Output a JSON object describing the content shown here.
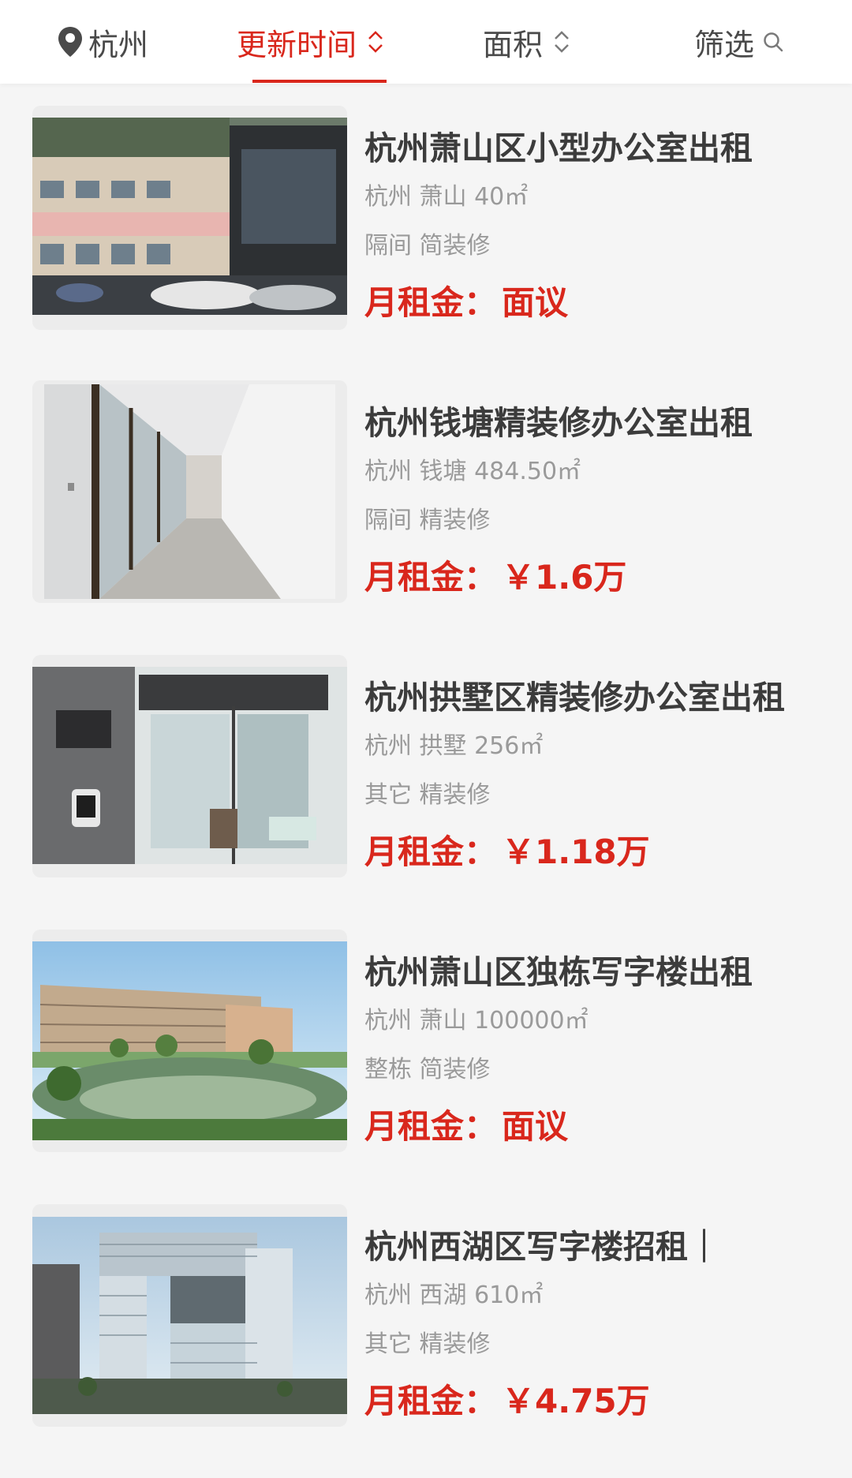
{
  "filter_bar": {
    "city": "杭州",
    "sort_update": "更新时间",
    "sort_area": "面积",
    "filter": "筛选"
  },
  "colors": {
    "accent": "#d9271c",
    "title": "#3c3c3c",
    "meta": "#9a9a9a"
  },
  "listings": [
    {
      "title": "杭州萧山区小型办公室出租",
      "location": "杭州 萧山 40㎡",
      "tags": "隔间 简装修",
      "price_label": "月租金：",
      "price_value": "面议"
    },
    {
      "title": "杭州钱塘精装修办公室出租",
      "location": "杭州 钱塘 484.50㎡",
      "tags": "隔间 精装修",
      "price_label": "月租金：",
      "price_value": "￥1.6万"
    },
    {
      "title": "杭州拱墅区精装修办公室出租",
      "location": "杭州 拱墅 256㎡",
      "tags": "其它 精装修",
      "price_label": "月租金：",
      "price_value": "￥1.18万"
    },
    {
      "title": "杭州萧山区独栋写字楼出租",
      "location": "杭州 萧山 100000㎡",
      "tags": "整栋 简装修",
      "price_label": "月租金：",
      "price_value": "面议"
    },
    {
      "title": "杭州西湖区写字楼招租｜",
      "location": "杭州 西湖 610㎡",
      "tags": "其它 精装修",
      "price_label": "月租金：",
      "price_value": "￥4.75万"
    }
  ]
}
